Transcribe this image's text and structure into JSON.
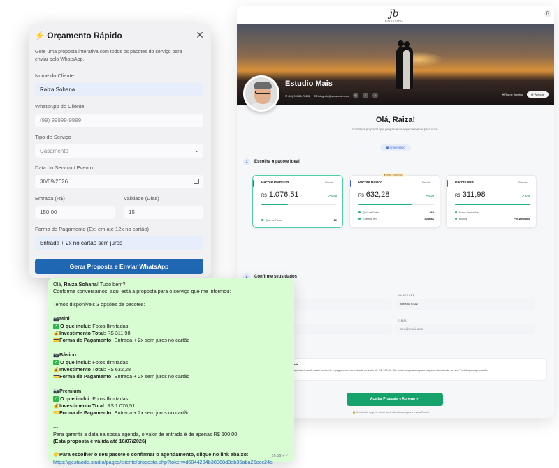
{
  "client_page": {
    "logo_text": "jb",
    "logo_subtext": "FOTOGRAFIA",
    "corner_badge": "R",
    "studio_name": "Estudio Mais",
    "phone": "(11) 99186-75432",
    "email": "fotografo@seuemail.com",
    "location": "Rio de Janeiro",
    "website_label": "Website",
    "greeting": "Olá, Raiza!",
    "greeting_sub": "Confira a proposta que preparamos especialmente para você.",
    "occasion_badge": "Aniversário",
    "step1_num": "1",
    "step1_label": "Escolha o pacote ideal",
    "packages": [
      {
        "title": "Pacote Premium",
        "dropdown": "Pacote",
        "price": "1.076,51",
        "trend": "0,00",
        "bar_fill": 0.35,
        "features": [
          {
            "label": "Qtd. de Fotos",
            "value": "10"
          }
        ]
      },
      {
        "title": "Pacote Básico",
        "dropdown": "Pacote",
        "badge": "Mais Escolhido",
        "price": "632,28",
        "trend": "0,00",
        "bar_fill": 0.7,
        "features": [
          {
            "label": "Qtd. de Fotos",
            "value": "360"
          },
          {
            "label": "Entrega em",
            "value": "30 dias"
          }
        ]
      },
      {
        "title": "Pacote Mini",
        "dropdown": "Pacote",
        "price": "311,98",
        "trend": "3,00",
        "bar_fill": 1.0,
        "features": [
          {
            "label": "Fotos Ilimitadas",
            "value": ""
          },
          {
            "label": "Bônus",
            "value": "Pré-wedding"
          }
        ]
      }
    ],
    "currency": "R$",
    "step2_num": "2",
    "step2_label": "Confirme seus dados",
    "whatsapp_label": "WHATSAPP",
    "whatsapp_value": "9990675432",
    "email_label": "E-MAIL",
    "email_value": "seu@email.com",
    "info_title": "ada",
    "info_text": "agenda é confirmada mediante o pagamento da entrada no valor de R$ 100,00. Os próximos passos para pagamento estarão no seu Portal após aprovação.",
    "accept_button": "Aceitar Proposta e Aprovar ✓",
    "secure_note": "Ambiente seguro. Você será direcionado para o seu Portal."
  },
  "modal": {
    "title": "Orçamento Rápido",
    "title_icon": "lightning-icon",
    "description": "Gere uma proposta interativa com todos os pacotes do serviço para enviar pelo WhatsApp.",
    "client_name_label": "Nome do Cliente",
    "client_name_value": "Raiza Sohana",
    "whatsapp_label": "WhatsApp do Cliente",
    "whatsapp_placeholder": "(99) 99999-9999",
    "service_type_label": "Tipo de Serviço",
    "service_type_value": "Casamento",
    "service_date_label": "Data do Serviço / Evento",
    "service_date_value": "30/09/2026",
    "entry_label": "Entrada (R$)",
    "entry_value": "150,00",
    "validity_label": "Validade (Dias)",
    "validity_value": "15",
    "payment_label": "Forma de Pagamento (Ex: em até 12x no cartão)",
    "payment_value": "Entrada + 2x no cartão sem juros",
    "submit_button": "Gerar Proposta e Enviar WhatsApp"
  },
  "whatsapp_message": {
    "greeting_prefix": "Olá, ",
    "client_name": "Raiza Sohana",
    "greeting_suffix": "! Tudo bem?",
    "line2": "Conforme conversamos, aqui está a proposta para o serviço que me informou:",
    "line3": "Temos disponíveis 3 opções de pacotes:",
    "included_label": "O que inclui:",
    "investment_label": "Investimento Total:",
    "payment_label": "Forma de Pagamento:",
    "packages": [
      {
        "name": "Mini",
        "includes": "Fotos Ilimitadas",
        "total": "R$ 311,98",
        "payment": "Entrada + 2x sem juros no cartão"
      },
      {
        "name": "Básico",
        "includes": "Fotos Ilimitadas",
        "total": "R$ 632,28",
        "payment": "Entrada + 2x sem juros no cartão"
      },
      {
        "name": "Premium",
        "includes": "Fotos Ilimitadas",
        "total": "R$ 1.076,51",
        "payment": "Entrada + 2x sem juros no cartão"
      }
    ],
    "divider": "---",
    "entry_note": "Para garantir a data na nossa agenda, o valor de entrada é de apenas R$ 100,00.",
    "validity_note": "(Esta proposta é válida até 16/07/2026)",
    "cta": "Para escolher o seu pacote e confirmar o agendamento, clique no link abaixo:",
    "link": "https://gestaode.studio/pages/cliente/proposta.php?token=d6044284b38068d3eb35aba25ecc24c",
    "time": "16:56 ✓✓"
  }
}
